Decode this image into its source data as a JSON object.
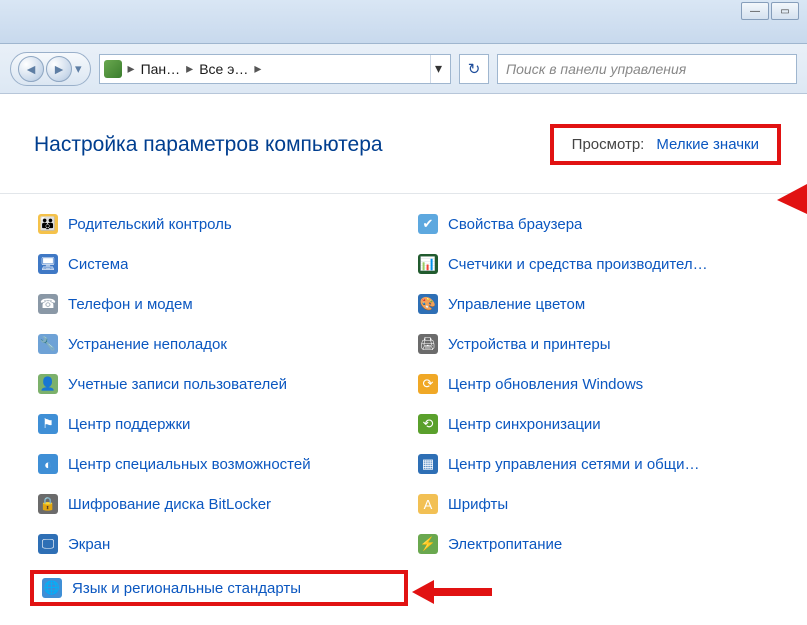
{
  "breadcrumb": {
    "part1": "Пан…",
    "part2": "Все э…"
  },
  "search": {
    "placeholder": "Поиск в панели управления"
  },
  "title": "Настройка параметров компьютера",
  "view": {
    "label": "Просмотр:",
    "value": "Мелкие значки"
  },
  "items_left": [
    {
      "label": "Родительский контроль",
      "name": "item-parental-control",
      "icon_bg": "#f5c24a",
      "icon_glyph": "👪"
    },
    {
      "label": "Система",
      "name": "item-system",
      "icon_bg": "#3f78c5",
      "icon_glyph": "🖥"
    },
    {
      "label": "Телефон и модем",
      "name": "item-phone-modem",
      "icon_bg": "#8a98a6",
      "icon_glyph": "☎"
    },
    {
      "label": "Устранение неполадок",
      "name": "item-troubleshoot",
      "icon_bg": "#6ea2d6",
      "icon_glyph": "🔧"
    },
    {
      "label": "Учетные записи пользователей",
      "name": "item-user-accounts",
      "icon_bg": "#7cb16b",
      "icon_glyph": "👤"
    },
    {
      "label": "Центр поддержки",
      "name": "item-action-center",
      "icon_bg": "#3f8fd6",
      "icon_glyph": "⚑"
    },
    {
      "label": "Центр специальных возможностей",
      "name": "item-ease-of-access",
      "icon_bg": "#3f8fd6",
      "icon_glyph": "◐"
    },
    {
      "label": "Шифрование диска BitLocker",
      "name": "item-bitlocker",
      "icon_bg": "#6b6b6b",
      "icon_glyph": "🔒"
    },
    {
      "label": "Экран",
      "name": "item-display",
      "icon_bg": "#2e6fb5",
      "icon_glyph": "🖵"
    },
    {
      "label": "Язык и региональные стандарты",
      "name": "item-region-language",
      "icon_bg": "#3f8fd6",
      "icon_glyph": "🌐",
      "highlight": true
    }
  ],
  "items_right": [
    {
      "label": "Свойства браузера",
      "name": "item-internet-options",
      "icon_bg": "#5da8df",
      "icon_glyph": "✔"
    },
    {
      "label": "Счетчики и средства производител…",
      "name": "item-performance",
      "icon_bg": "#215b2e",
      "icon_glyph": "📊"
    },
    {
      "label": "Управление цветом",
      "name": "item-color-mgmt",
      "icon_bg": "#2e6fb5",
      "icon_glyph": "🎨"
    },
    {
      "label": "Устройства и принтеры",
      "name": "item-devices-printers",
      "icon_bg": "#6b6b6b",
      "icon_glyph": "🖨"
    },
    {
      "label": "Центр обновления Windows",
      "name": "item-windows-update",
      "icon_bg": "#f0a826",
      "icon_glyph": "⟳"
    },
    {
      "label": "Центр синхронизации",
      "name": "item-sync-center",
      "icon_bg": "#5aa02c",
      "icon_glyph": "⟲"
    },
    {
      "label": "Центр управления сетями и общи…",
      "name": "item-network-sharing",
      "icon_bg": "#2e6fb5",
      "icon_glyph": "▦"
    },
    {
      "label": "Шрифты",
      "name": "item-fonts",
      "icon_bg": "#f2c054",
      "icon_glyph": "A"
    },
    {
      "label": "Электропитание",
      "name": "item-power-options",
      "icon_bg": "#6aa84f",
      "icon_glyph": "⚡"
    }
  ]
}
